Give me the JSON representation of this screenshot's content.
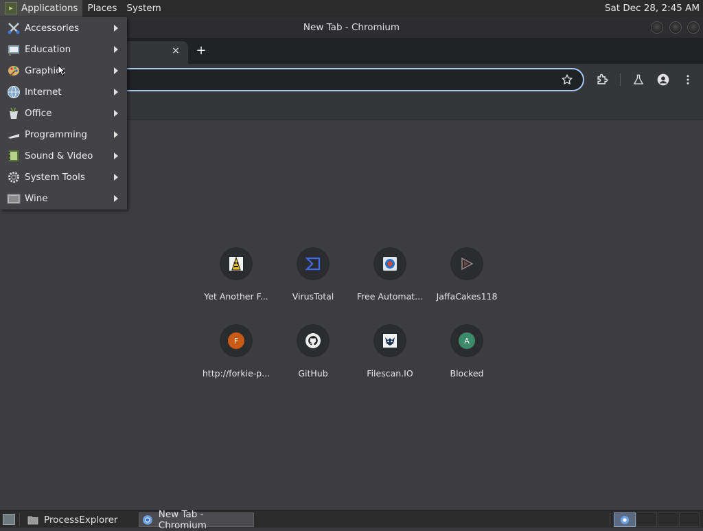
{
  "top_panel": {
    "menus": [
      {
        "label": "Applications"
      },
      {
        "label": "Places"
      },
      {
        "label": "System"
      }
    ],
    "clock": "Sat Dec 28,  2:45 AM"
  },
  "window": {
    "title": "New Tab - Chromium",
    "tab_close": "×",
    "new_tab": "+"
  },
  "applications_menu": {
    "items": [
      {
        "label": "Accessories",
        "icon": "accessories-icon"
      },
      {
        "label": "Education",
        "icon": "education-icon"
      },
      {
        "label": "Graphics",
        "icon": "graphics-icon"
      },
      {
        "label": "Internet",
        "icon": "internet-globe-icon"
      },
      {
        "label": "Office",
        "icon": "office-icon"
      },
      {
        "label": "Programming",
        "icon": "programming-icon"
      },
      {
        "label": "Sound & Video",
        "icon": "sound-video-icon"
      },
      {
        "label": "System Tools",
        "icon": "gear-icon"
      },
      {
        "label": "Wine",
        "icon": "wine-icon"
      }
    ]
  },
  "shortcuts": [
    {
      "title": "Yet Another F...",
      "icon": "yara-favicon"
    },
    {
      "title": "VirusTotal",
      "icon": "virustotal-favicon"
    },
    {
      "title": "Free Automat...",
      "icon": "automation-favicon"
    },
    {
      "title": "JaffaCakes118",
      "icon": "jaffacakes-favicon"
    },
    {
      "title": "http://forkie-p...",
      "icon": "letter-f-favicon",
      "letter": "F"
    },
    {
      "title": "GitHub",
      "icon": "github-favicon"
    },
    {
      "title": "Filescan.IO",
      "icon": "filescan-favicon"
    },
    {
      "title": "Blocked",
      "icon": "letter-a-favicon",
      "letter": "A"
    }
  ],
  "taskbar": {
    "items": [
      {
        "label": "ProcessExplorer"
      },
      {
        "label": "New Tab - Chromium"
      }
    ]
  },
  "colors": {
    "accent_omnibox_border": "#a8c7fa",
    "letter_f_badge": "#c75a15",
    "letter_a_badge": "#3b8a6b"
  }
}
